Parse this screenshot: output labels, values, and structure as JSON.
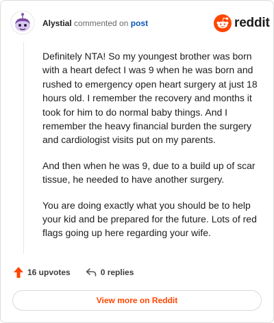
{
  "header": {
    "author": "Alystial",
    "action": " commented on ",
    "post_link": "post"
  },
  "brand": {
    "wordmark": "reddit",
    "color": "#ff4500"
  },
  "comment": {
    "paragraphs": [
      "Definitely NTA! So my youngest brother was born with a heart defect I was 9 when he was born and rushed to emergency open heart surgery at just 18 hours old. I remember the recovery and months it took for him to do normal baby things. And I remember the heavy financial burden the surgery and cardiologist visits put on my parents.",
      "And then when he was 9, due to a build up of scar tissue, he needed to have another surgery.",
      "You are doing exactly what you should be to help your kid and be prepared for the future. Lots of red flags going up here regarding your wife."
    ]
  },
  "footer": {
    "upvotes": "16 upvotes",
    "replies": "0 replies",
    "upvote_icon": "upvote-arrow-icon",
    "reply_icon": "reply-arrow-icon"
  },
  "view_more_label": "View more on Reddit"
}
